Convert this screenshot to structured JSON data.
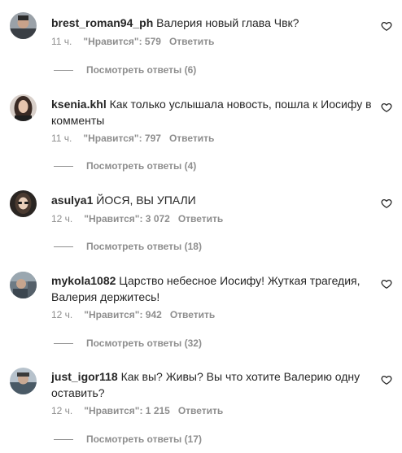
{
  "comments": [
    {
      "username": "brest_roman94_ph",
      "text": "Валерия новый глава Чвк?",
      "time": "11 ч.",
      "likes": "\"Нравится\": 579",
      "reply_label": "Ответить",
      "view_replies": "Посмотреть ответы (6)"
    },
    {
      "username": "ksenia.khl",
      "text": "Как только услышала новость, пошла к Иосифу в комменты",
      "time": "11 ч.",
      "likes": "\"Нравится\": 797",
      "reply_label": "Ответить",
      "view_replies": "Посмотреть ответы (4)"
    },
    {
      "username": "asulya1",
      "text": "ЙОСЯ, ВЫ УПАЛИ",
      "time": "12 ч.",
      "likes": "\"Нравится\": 3 072",
      "reply_label": "Ответить",
      "view_replies": "Посмотреть ответы (18)"
    },
    {
      "username": "mykola1082",
      "text": "Царство небесное Иосифу! Жуткая трагедия, Валерия держитесь!",
      "time": "12 ч.",
      "likes": "\"Нравится\": 942",
      "reply_label": "Ответить",
      "view_replies": "Посмотреть ответы (32)"
    },
    {
      "username": "just_igor118",
      "text": "Как вы? Живы? Вы что хотите Валерию одну оставить?",
      "time": "12 ч.",
      "likes": "\"Нравится\": 1 215",
      "reply_label": "Ответить",
      "view_replies": "Посмотреть ответы (17)"
    }
  ],
  "colors": {
    "text": "#262626",
    "muted": "#8e8e8e",
    "background": "#ffffff"
  },
  "icons": {
    "like": "heart-outline-icon"
  }
}
